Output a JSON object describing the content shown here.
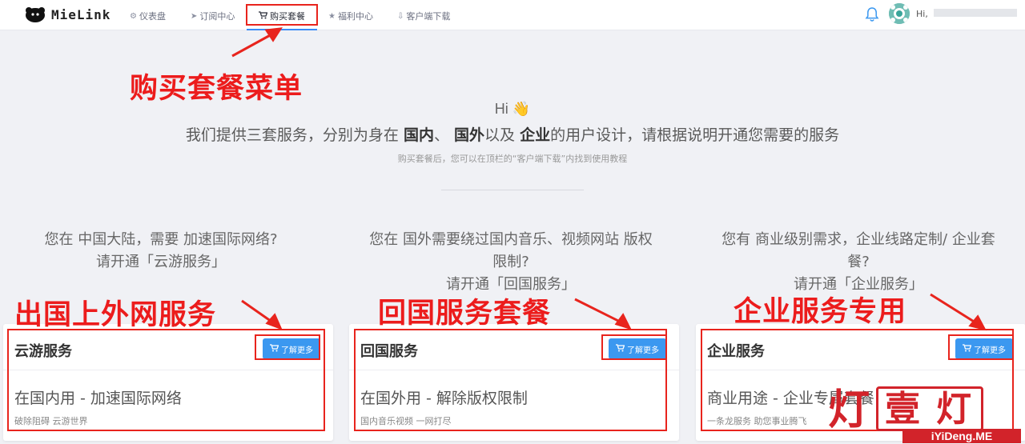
{
  "nav": {
    "brand": "MieLink",
    "items": [
      {
        "label": "仪表盘",
        "icon": "dashboard-icon",
        "glyph": "⚙"
      },
      {
        "label": "订阅中心",
        "icon": "send-icon",
        "glyph": "➤"
      },
      {
        "label": "购买套餐",
        "icon": "cart-icon",
        "glyph": "🛒"
      },
      {
        "label": "福利中心",
        "icon": "star-icon",
        "glyph": "★"
      },
      {
        "label": "客户端下载",
        "icon": "download-icon",
        "glyph": "⇩"
      }
    ],
    "active_index": 2,
    "user_greeting": "Hi,"
  },
  "hero": {
    "hi": "Hi 👋",
    "line_parts": [
      "我们提供三套服务，分别为身在 ",
      "国内",
      "、 ",
      "国外",
      "以及 ",
      "企业",
      "的用户设计，请根据说明开通您需要的服务"
    ],
    "sub": "购买套餐后，您可以在顶栏的“客户端下载”内找到使用教程"
  },
  "questions": [
    "您在 中国大陆，需要 加速国际网络?\n请开通「云游服务」",
    "您在 国外需要绕过国内音乐、视频网站 版权限制?\n请开通「回国服务」",
    "您有 商业级别需求，企业线路定制/ 企业套餐?\n请开通「企业服务」"
  ],
  "cards": [
    {
      "title": "云游服务",
      "button": "了解更多",
      "main": "在国内用 - 加速国际网络",
      "sub": "破除阻碍 云游世界"
    },
    {
      "title": "回国服务",
      "button": "了解更多",
      "main": "在国外用 - 解除版权限制",
      "sub": "国内音乐视频 一网打尽"
    },
    {
      "title": "企业服务",
      "button": "了解更多",
      "main": "商业用途 - 企业专属套餐",
      "sub": "一条龙服务 助您事业腾飞"
    }
  ],
  "annotations": {
    "menu": "购买套餐菜单",
    "overseas": "出国上外网服务",
    "home": "回国服务套餐",
    "enterprise": "企业服务专用",
    "color": "#e8241d"
  },
  "watermark": {
    "lamp": "灯",
    "seal_left": "壹",
    "seal_right": "灯",
    "domain": "iYiDeng.ME"
  },
  "colors": {
    "accent": "#3b98f0",
    "page_bg": "#f0f1f5"
  }
}
